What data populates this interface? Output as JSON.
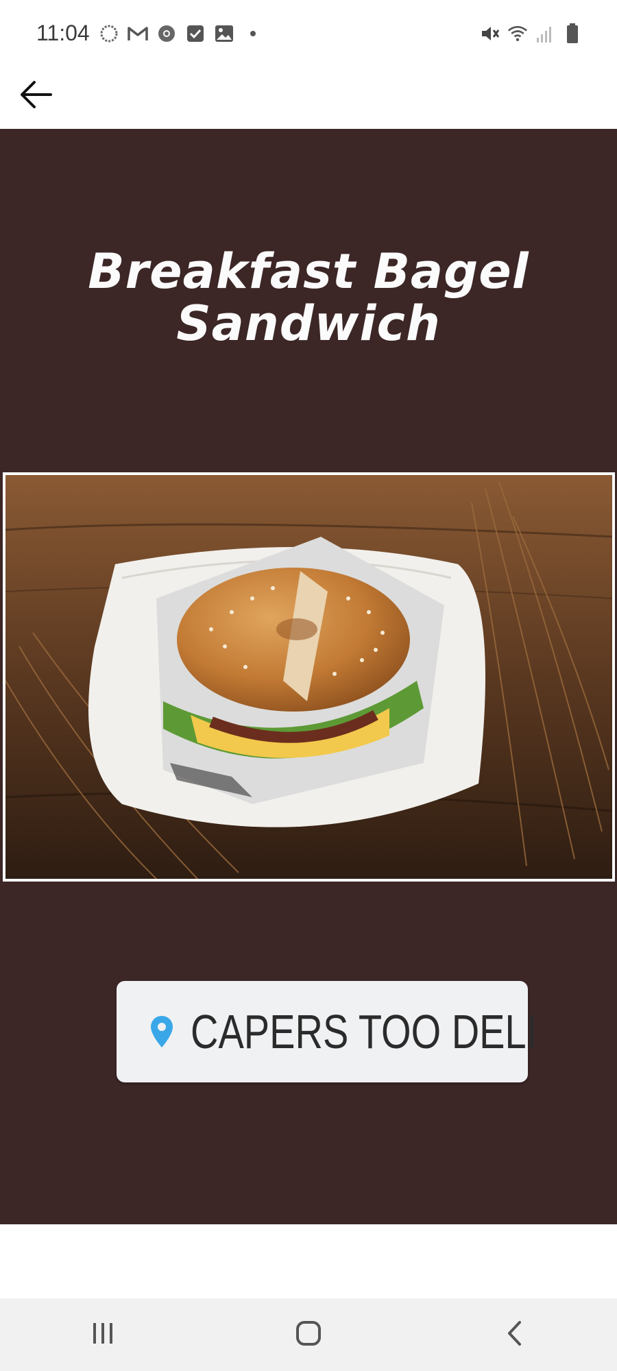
{
  "status_bar": {
    "time": "11:04",
    "left_icons": [
      "loading-icon",
      "gmail-icon",
      "chrome-icon",
      "check-icon",
      "gallery-icon",
      "dot-icon"
    ],
    "right_icons": [
      "mute-icon",
      "wifi-icon",
      "signal-icon",
      "battery-icon"
    ]
  },
  "app_bar": {
    "back_icon": "arrow-back-icon"
  },
  "post": {
    "title_line1": "Breakfast Bagel",
    "title_line2": "Sandwich",
    "location_label": "CAPERS TOO DELI",
    "background_color": "#3c2626",
    "location_pin_color": "#3aa8e8"
  },
  "nav_bar": {
    "items": [
      "recent-apps-icon",
      "home-icon",
      "back-icon"
    ]
  }
}
